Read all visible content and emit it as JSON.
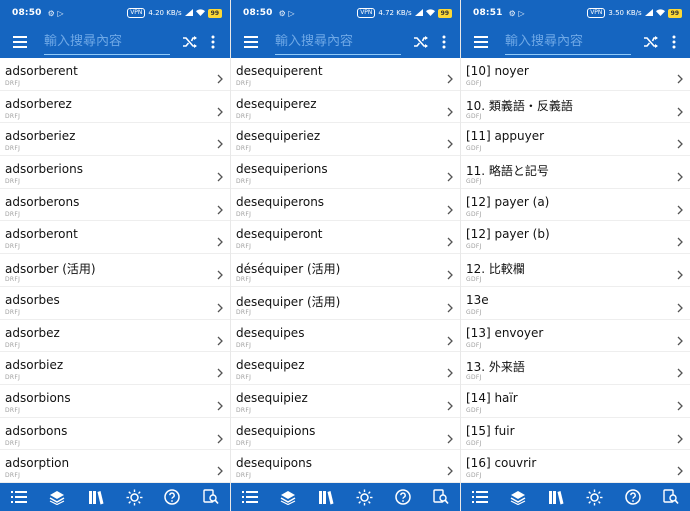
{
  "colors": {
    "primary": "#1565c0",
    "search_line": "#90caf9",
    "battery": "#fdd835"
  },
  "screens": [
    {
      "status": {
        "time": "08:50",
        "icons": "⚙ ▷",
        "right": "4.20 KB/s",
        "vpn": "VPN",
        "battery": "99"
      },
      "search": {
        "placeholder": "輸入搜尋內容"
      },
      "rows": [
        {
          "word": "adsorberent",
          "tag": "DRFJ"
        },
        {
          "word": "adsorberez",
          "tag": "DRFJ"
        },
        {
          "word": "adsorberiez",
          "tag": "DRFJ"
        },
        {
          "word": "adsorberions",
          "tag": "DRFJ"
        },
        {
          "word": "adsorberons",
          "tag": "DRFJ"
        },
        {
          "word": "adsorberont",
          "tag": "DRFJ"
        },
        {
          "word": "adsorber (活用)",
          "tag": "DRFJ"
        },
        {
          "word": "adsorbes",
          "tag": "DRFJ"
        },
        {
          "word": "adsorbez",
          "tag": "DRFJ"
        },
        {
          "word": "adsorbiez",
          "tag": "DRFJ"
        },
        {
          "word": "adsorbions",
          "tag": "DRFJ"
        },
        {
          "word": "adsorbons",
          "tag": "DRFJ"
        },
        {
          "word": "adsorption",
          "tag": "DRFJ"
        }
      ]
    },
    {
      "status": {
        "time": "08:50",
        "icons": "⚙ ▷",
        "right": "4.72 KB/s",
        "vpn": "VPN",
        "battery": "99"
      },
      "search": {
        "placeholder": "輸入搜尋內容"
      },
      "rows": [
        {
          "word": "desequiperent",
          "tag": "DRFJ"
        },
        {
          "word": "desequiperez",
          "tag": "DRFJ"
        },
        {
          "word": "desequiperiez",
          "tag": "DRFJ"
        },
        {
          "word": "desequiperions",
          "tag": "DRFJ"
        },
        {
          "word": "desequiperons",
          "tag": "DRFJ"
        },
        {
          "word": "desequiperont",
          "tag": "DRFJ"
        },
        {
          "word": "déséquiper (活用)",
          "tag": "DRFJ"
        },
        {
          "word": "desequiper (活用)",
          "tag": "DRFJ"
        },
        {
          "word": "desequipes",
          "tag": "DRFJ"
        },
        {
          "word": "desequipez",
          "tag": "DRFJ"
        },
        {
          "word": "desequipiez",
          "tag": "DRFJ"
        },
        {
          "word": "desequipions",
          "tag": "DRFJ"
        },
        {
          "word": "desequipons",
          "tag": "DRFJ"
        }
      ]
    },
    {
      "status": {
        "time": "08:51",
        "icons": "⚙ ▷",
        "right": "3.50 KB/s",
        "vpn": "VPN",
        "battery": "99"
      },
      "search": {
        "placeholder": "輸入搜尋內容"
      },
      "rows": [
        {
          "word": "[10] noyer",
          "tag": "GDFJ"
        },
        {
          "word": "10. 類義語・反義語",
          "tag": "GDFJ"
        },
        {
          "word": "[11] appuyer",
          "tag": "GDFJ"
        },
        {
          "word": "11. 略語と記号",
          "tag": "GDFJ"
        },
        {
          "word": "[12] payer (a)",
          "tag": "GDFJ"
        },
        {
          "word": "[12] payer (b)",
          "tag": "GDFJ"
        },
        {
          "word": "12. 比較欄",
          "tag": "GDFJ"
        },
        {
          "word": "13e",
          "tag": "GDFJ"
        },
        {
          "word": "[13] envoyer",
          "tag": "GDFJ"
        },
        {
          "word": "13. 外来語",
          "tag": "GDFJ"
        },
        {
          "word": "[14] haïr",
          "tag": "GDFJ"
        },
        {
          "word": "[15] fuir",
          "tag": "GDFJ"
        },
        {
          "word": "[16] couvrir",
          "tag": "GDFJ"
        }
      ]
    }
  ],
  "bottom_nav": [
    {
      "icon": "list-icon"
    },
    {
      "icon": "layers-icon"
    },
    {
      "icon": "books-icon"
    },
    {
      "icon": "brightness-icon"
    },
    {
      "icon": "help-icon"
    },
    {
      "icon": "search-history-icon"
    }
  ]
}
